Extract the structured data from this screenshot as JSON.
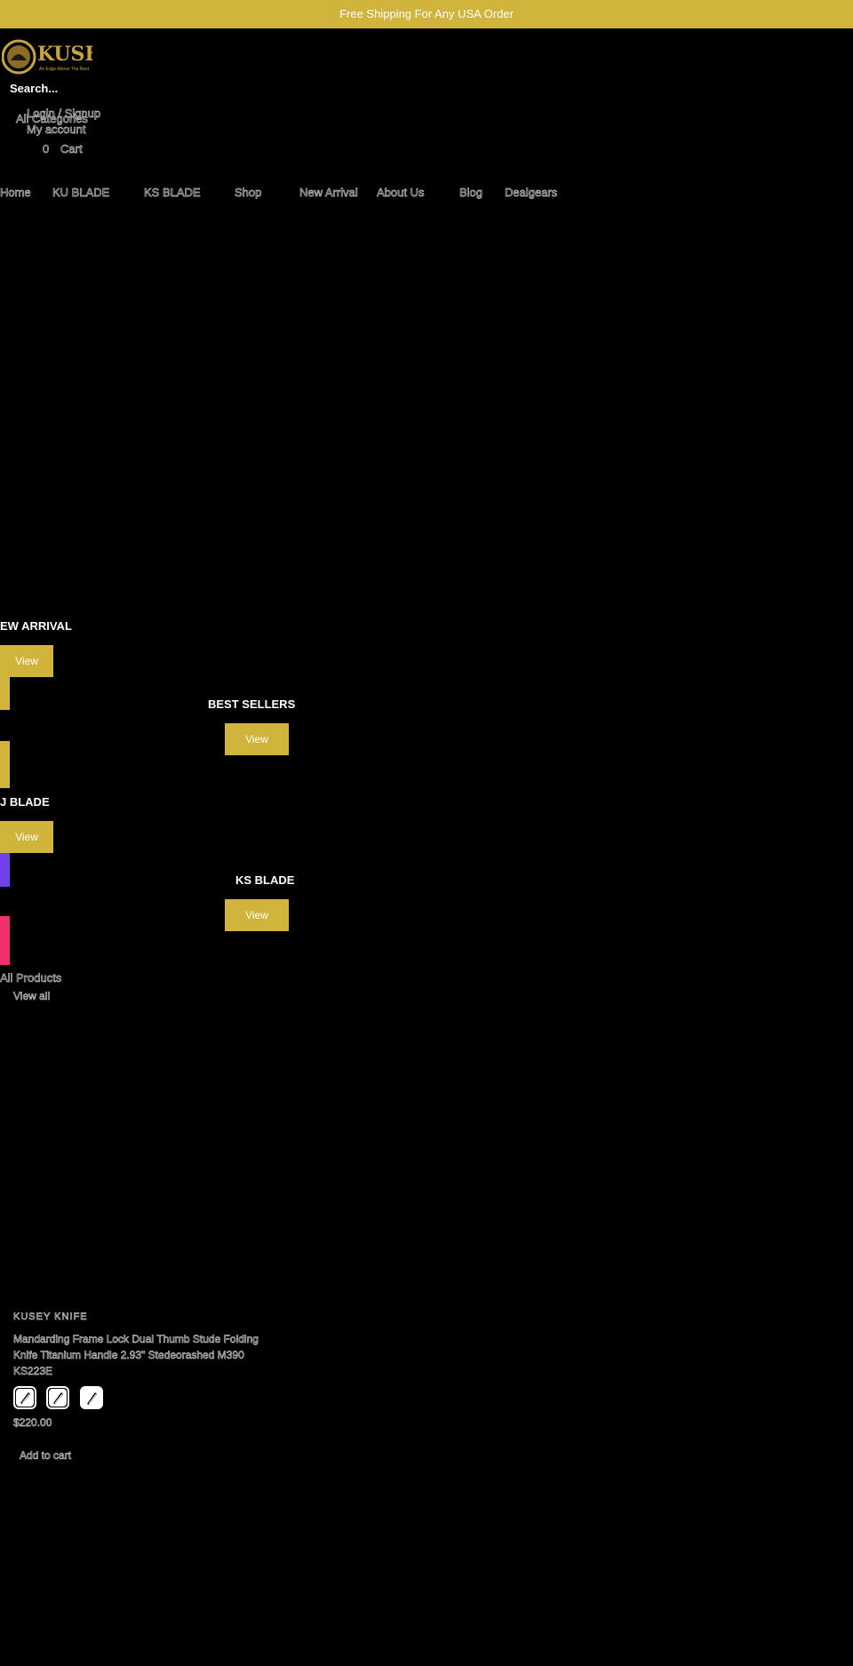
{
  "announcement": "Free Shipping For Any USA Order",
  "colors": {
    "accent": "#d0b43c",
    "background": "#000000",
    "purple": "#7043e8",
    "pink": "#f0306a"
  },
  "header": {
    "logo_text": "KUSEY",
    "logo_tagline": "An Edge Above The Rest",
    "search_placeholder": "Search...",
    "all_categories": "All Categories",
    "login": "Login / Signup",
    "account": "My account",
    "cart_count": "0",
    "cart_label": "Cart"
  },
  "nav": [
    "Home",
    "KU BLADE",
    "KS BLADE",
    "Shop",
    "New Arrival",
    "About Us",
    "Blog",
    "Dealgears"
  ],
  "promos": [
    {
      "title": "EW ARRIVAL",
      "button": "View"
    },
    {
      "title": "BEST SELLERS",
      "button": "View"
    },
    {
      "title": "J BLADE",
      "button": "View"
    },
    {
      "title": "KS BLADE",
      "button": "View"
    }
  ],
  "all_products": {
    "heading": "All Products",
    "link": "View all"
  },
  "product": {
    "vendor": "KUSEY KNIFE",
    "title_lines": [
      "Mandarding Frame Lock Dual Thumb Stude Folding",
      "Knife Titanium Handle 2.93\" Stedeorashed M390",
      "KS223E"
    ],
    "swatches": [
      "swatch-1",
      "swatch-2",
      "swatch-3"
    ],
    "price": "$220.00",
    "add_to_cart": "Add to cart"
  }
}
